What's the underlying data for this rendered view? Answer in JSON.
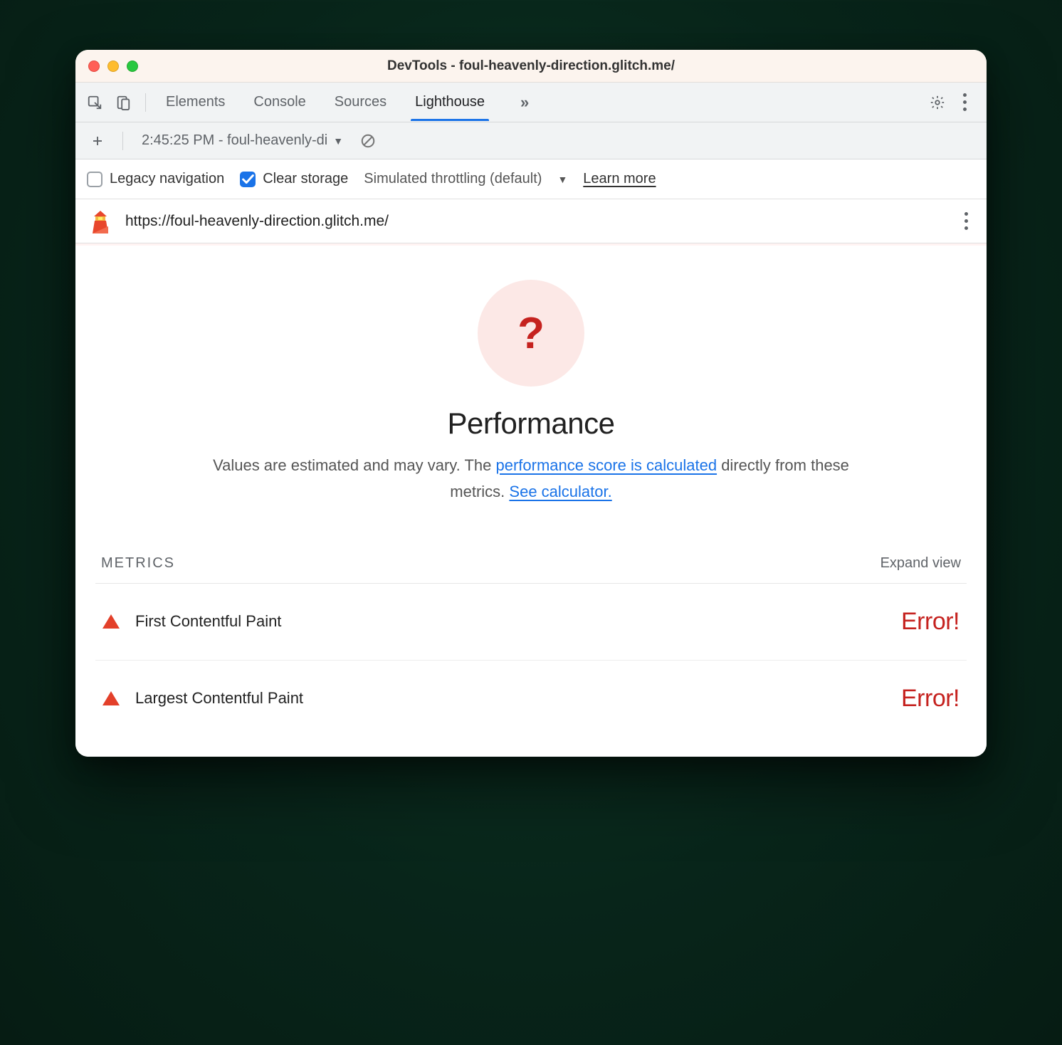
{
  "window": {
    "title": "DevTools - foul-heavenly-direction.glitch.me/"
  },
  "tabs": {
    "items": [
      "Elements",
      "Console",
      "Sources",
      "Lighthouse"
    ],
    "active": "Lighthouse"
  },
  "secondbar": {
    "report_label": "2:45:25 PM - foul-heavenly-di"
  },
  "options": {
    "legacy_label": "Legacy navigation",
    "clear_label": "Clear storage",
    "throttling_label": "Simulated throttling (default)",
    "learn_more": "Learn more"
  },
  "url": "https://foul-heavenly-direction.glitch.me/",
  "report": {
    "score_mark": "?",
    "title": "Performance",
    "subtitle_prefix": "Values are estimated and may vary. The ",
    "link1": "performance score is calculated",
    "subtitle_mid": " directly from these metrics. ",
    "link2": "See calculator."
  },
  "metrics": {
    "heading": "METRICS",
    "expand": "Expand view",
    "items": [
      {
        "name": "First Contentful Paint",
        "value": "Error!"
      },
      {
        "name": "Largest Contentful Paint",
        "value": "Error!"
      }
    ]
  }
}
